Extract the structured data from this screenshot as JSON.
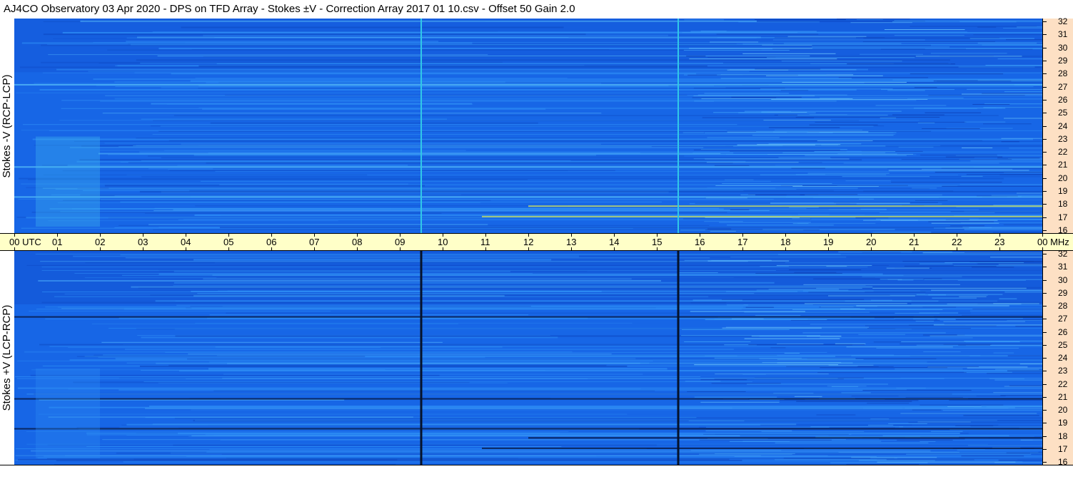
{
  "title": "AJ4CO Observatory  03 Apr 2020  -  DPS on TFD Array  -  Stokes ±V  -  Correction Array 2017 01 10.csv  -  Offset 50  Gain 2.0",
  "panels": {
    "top_label": "Stokes -V (RCP-LCP)",
    "bottom_label": "Stokes +V (LCP-RCP)"
  },
  "time_axis": {
    "labels": [
      "00 UTC",
      "01",
      "02",
      "03",
      "04",
      "05",
      "06",
      "07",
      "08",
      "09",
      "10",
      "11",
      "12",
      "13",
      "14",
      "15",
      "16",
      "17",
      "18",
      "19",
      "20",
      "21",
      "22",
      "23",
      "00 MHz"
    ]
  },
  "freq_axis": {
    "labels": [
      "32",
      "31",
      "30",
      "29",
      "28",
      "27",
      "26",
      "25",
      "24",
      "23",
      "22",
      "21",
      "20",
      "19",
      "18",
      "17",
      "16"
    ]
  },
  "colors": {
    "spectrogram_base": "#1766e6",
    "spectrogram_light": "#2a8ff4",
    "top_marker_line": "#30c8e8",
    "bottom_marker_line": "#05122a",
    "time_axis_bg": "#ffffc8",
    "freq_axis_bg": "#fde0c4"
  },
  "markers_utc_hours": [
    9.5,
    15.5
  ],
  "bright_feature_rows_mhz": [
    17.1,
    17.9,
    18.6,
    20.9,
    27.2
  ]
}
